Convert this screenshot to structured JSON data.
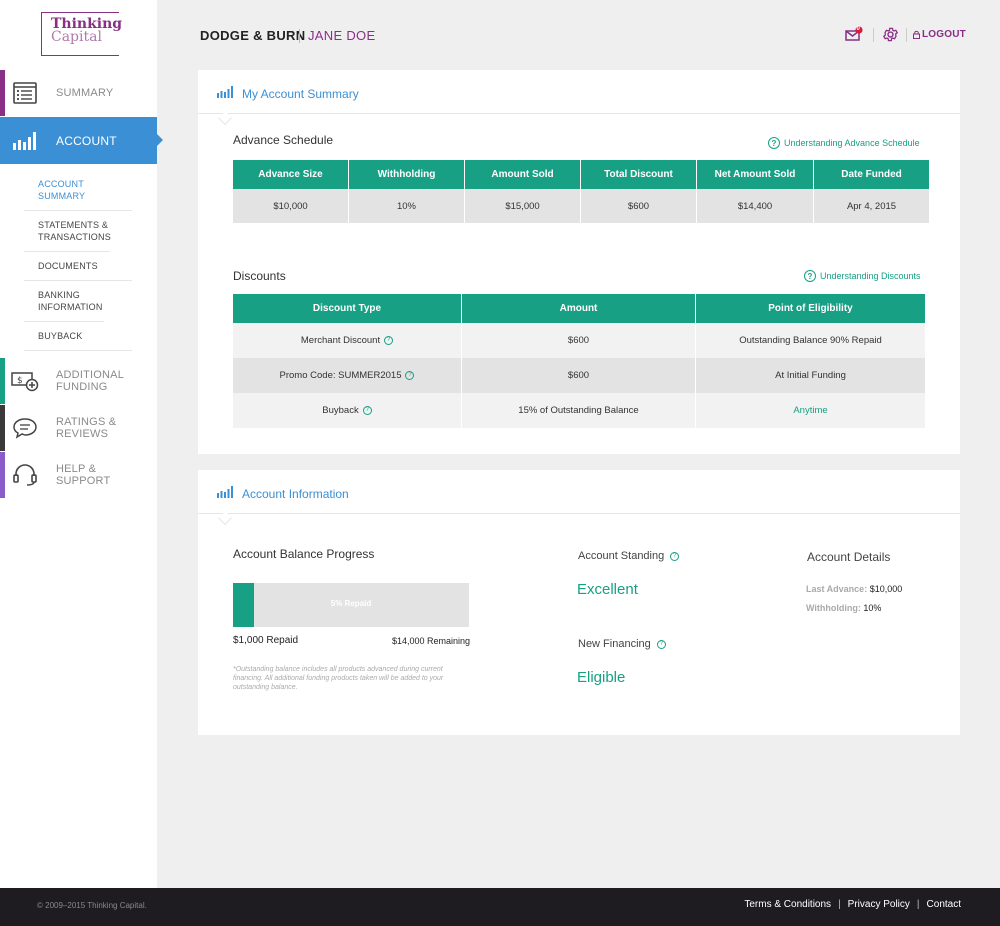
{
  "logo": {
    "line1": "Thinking",
    "line2": "Capital"
  },
  "header": {
    "brand": "DODGE & BURN",
    "user": "JANE DOE",
    "mail_badge": "0",
    "logout": "LOGOUT"
  },
  "nav": {
    "summary": "SUMMARY",
    "account": "ACCOUNT",
    "sub": [
      "ACCOUNT SUMMARY",
      "STATEMENTS & TRANSACTIONS",
      "DOCUMENTS",
      "BANKING INFORMATION",
      "BUYBACK"
    ],
    "funding": "ADDITIONAL FUNDING",
    "reviews": "RATINGS & REVIEWS",
    "help": "HELP & SUPPORT"
  },
  "colors": {
    "accent": "#17a084",
    "blue": "#3b8fd4",
    "brand": "#8a2f86"
  },
  "summary_card": {
    "title": "My Account Summary",
    "schedule_title": "Advance Schedule",
    "schedule_help": "Understanding Advance Schedule",
    "schedule_headers": [
      "Advance Size",
      "Withholding",
      "Amount Sold",
      "Total Discount",
      "Net Amount Sold",
      "Date Funded"
    ],
    "schedule_values": [
      "$10,000",
      "10%",
      "$15,000",
      "$600",
      "$14,400",
      "Apr 4, 2015"
    ],
    "discounts_title": "Discounts",
    "discounts_help": "Understanding Discounts",
    "discount_headers": [
      "Discount Type",
      "Amount",
      "Point of Eligibility"
    ],
    "discount_rows": [
      [
        "Merchant Discount",
        "$600",
        "Outstanding Balance 90% Repaid"
      ],
      [
        "Promo Code: SUMMER2015",
        "$600",
        "At Initial Funding"
      ],
      [
        "Buyback",
        "15% of Outstanding Balance",
        "Anytime"
      ]
    ]
  },
  "info_card": {
    "title": "Account Information",
    "progress_title": "Account Balance Progress",
    "progress_fraction": 0.09,
    "progress_label": "5% Repaid",
    "repaid": "$1,000 Repaid",
    "remaining": "$14,000 Remaining",
    "footnote": "*Outstanding balance includes all products advanced during current financing. All additional funding products taken will be added to your outstanding balance.",
    "standing_title": "Account Standing",
    "standing_value": "Excellent",
    "financing_title": "New Financing",
    "financing_value": "Eligible",
    "details_title": "Account Details",
    "last_advance_label": "Last Advance:",
    "last_advance_value": "$10,000",
    "withholding_label": "Withholding:",
    "withholding_value": "10%"
  },
  "footer": {
    "copyright": "© 2009–2015 Thinking Capital.",
    "links": [
      "Terms & Conditions",
      "Privacy Policy",
      "Contact"
    ]
  }
}
